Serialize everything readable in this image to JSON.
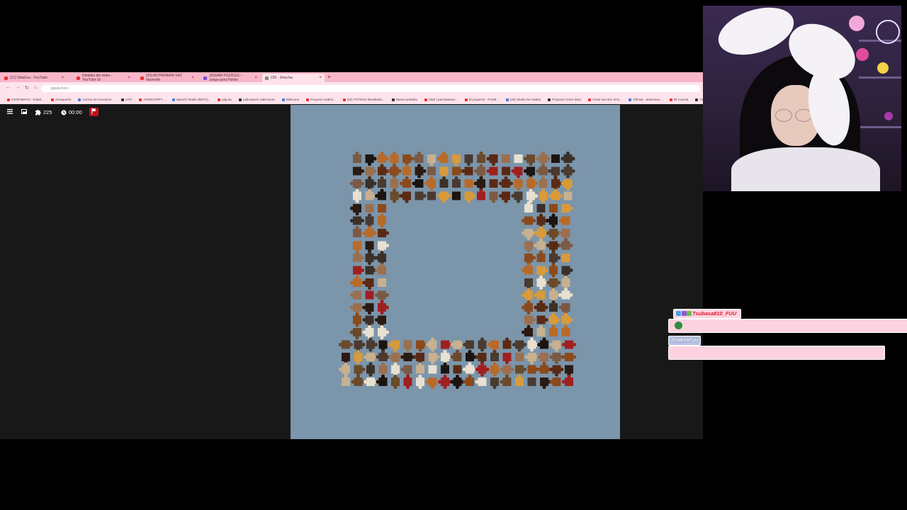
{
  "browser": {
    "tabs": [
      {
        "label": "(21) ShiaFuu - YouTube",
        "favicon": "youtube-icon"
      },
      {
        "label": "Detalles del video - YouTube St",
        "favicon": "youtube-icon"
      },
      {
        "label": "(23) MI PRIMERA VEZ haciendo",
        "favicon": "youtube-icon"
      },
      {
        "label": "JIGSAW PUZZLES – Juego para Partes",
        "favicon": "puzzle-icon"
      },
      {
        "label": "225 - Shia.fuu",
        "favicon": "puzzle-icon",
        "active": true
      }
    ],
    "url": "jigsaw.fun/...",
    "bookmarks": [
      "GIVEAWAYS - Solicit...",
      "Aeropuerto",
      "Cursos de Invocacio...",
      "UTO",
      "ANIMCHOPT...",
      "Speech Studio (BETA)...",
      "yag.ha",
      "Laboratorio Sabrosura",
      "Welcome",
      "Proyecto Sabris...",
      "(22) TOTEOS Resultado...",
      "Nueva pestaña",
      "Start | purchasesvi...",
      "El proyecto - Portal...",
      "(26) Studio De Hadas",
      "Proyecto Creer éxito",
      "Crear sus vid- el la...",
      "GitHub - ariesunes...",
      "Mi Cuenta",
      "YouTube",
      "Nueva Galería"
    ]
  },
  "puzzle": {
    "piece_count": "225",
    "timer": "00:00",
    "board_color": "#7b95ab",
    "flag_color": "#c0121a"
  },
  "chat": {
    "messages": [
      {
        "user": "Tsubasa810_FUU",
        "name_color": "#e0142c",
        "has_emote": true
      },
      {
        "user": "ShakiraFuu",
        "name_color": "#b8c3e6"
      }
    ]
  },
  "colors": {
    "accent_pink": "#f7b7c8",
    "chat_bubble": "#fcd2df"
  }
}
